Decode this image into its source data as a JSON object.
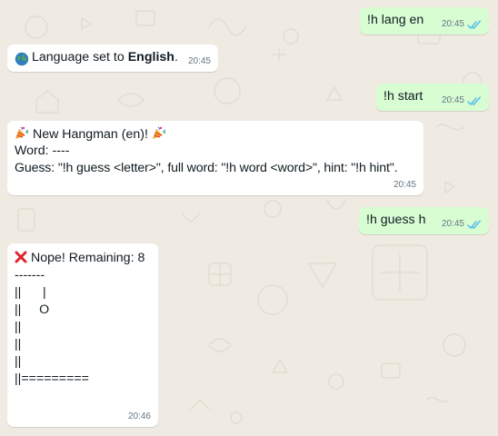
{
  "messages": [
    {
      "direction": "outgoing",
      "text": "!h lang en",
      "time": "20:45",
      "status": "read"
    },
    {
      "direction": "incoming",
      "icon": "globe-icon",
      "text_prefix": "Language set to ",
      "text_bold": "English",
      "text_suffix": ".",
      "time": "20:45"
    },
    {
      "direction": "outgoing",
      "text": "!h start",
      "time": "20:45",
      "status": "read"
    },
    {
      "direction": "incoming",
      "icon_start": "party-popper-icon",
      "icon_end": "party-popper-icon",
      "title": "New Hangman (en)!",
      "lines": [
        "Word: ----",
        "Guess: \"!h guess <letter>\", full word: \"!h word <word>\", hint: \"!h hint\"."
      ],
      "time": "20:45"
    },
    {
      "direction": "outgoing",
      "text": "!h guess h",
      "time": "20:45",
      "status": "read"
    },
    {
      "direction": "incoming",
      "icon": "cross-mark-icon",
      "title": "Nope! Remaining: 8",
      "lines": [
        "-------",
        "||      |",
        "||     O",
        "||",
        "||",
        "||",
        "||========="
      ],
      "time": "20:46"
    }
  ],
  "colors": {
    "outgoing_bubble": "#d9fdd3",
    "incoming_bubble": "#ffffff",
    "background": "#efeae2",
    "read_ticks": "#53bdeb",
    "timestamp": "#667781"
  }
}
